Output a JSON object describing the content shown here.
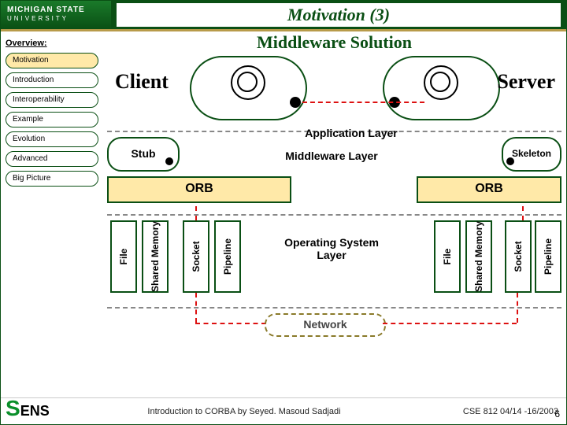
{
  "university": {
    "line1": "MICHIGAN STATE",
    "line2": "UNIVERSITY"
  },
  "title": "Motivation (3)",
  "header": "Middleware Solution",
  "sidebar": {
    "heading": "Overview:",
    "items": [
      "Motivation",
      "Introduction",
      "Interoperability",
      "Example",
      "Evolution",
      "Advanced",
      "Big Picture"
    ],
    "selected": 0
  },
  "labels": {
    "client": "Client",
    "server": "Server",
    "app_layer": "Application Layer",
    "stub": "Stub",
    "skeleton": "Skeleton",
    "middleware_layer": "Middleware Layer",
    "orb": "ORB",
    "os_layer": "Operating System Layer",
    "network": "Network"
  },
  "io_left": [
    "File",
    "Shared Memory",
    "Socket",
    "Pipeline"
  ],
  "io_right": [
    "File",
    "Shared Memory",
    "Socket",
    "Pipeline"
  ],
  "footer": {
    "logo": "SENS",
    "center": "Introduction to CORBA by Seyed. Masoud Sadjadi",
    "course": "CSE 812   04/14 -16/2003",
    "page": "6"
  }
}
